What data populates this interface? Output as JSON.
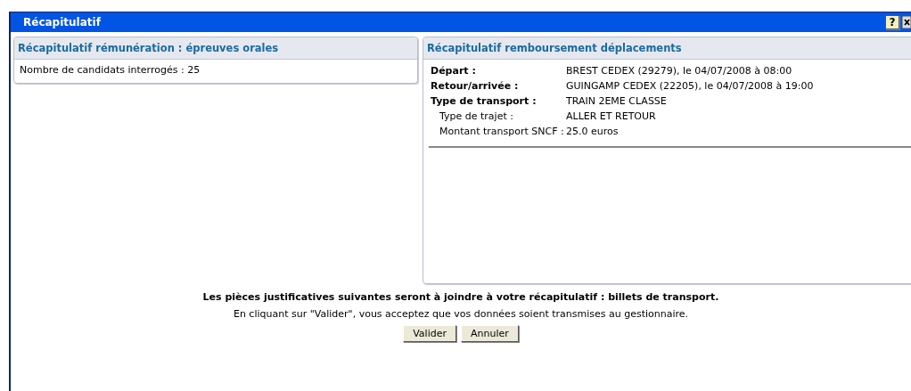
{
  "window": {
    "title": "Récapitulatif",
    "help_button": "?"
  },
  "remuneration": {
    "title": "Récapitulatif rémunération : épreuves orales",
    "line": "Nombre de candidats interrogés : 25"
  },
  "deplacements": {
    "title": "Récapitulatif remboursement déplacements",
    "rows": [
      {
        "kind": "main",
        "label": "Départ :",
        "value": "BREST CEDEX (29279), le 04/07/2008 à 08:00"
      },
      {
        "kind": "main",
        "label": "Retour/arrivée :",
        "value": "GUINGAMP CEDEX (22205), le 04/07/2008 à 19:00"
      },
      {
        "kind": "main",
        "label": "Type de transport :",
        "value": "TRAIN 2EME CLASSE"
      },
      {
        "kind": "sub",
        "label": "Type de trajet :",
        "value": "ALLER ET RETOUR"
      },
      {
        "kind": "sub",
        "label": "Montant transport SNCF :",
        "value": "25.0 euros"
      }
    ]
  },
  "notice": "Les pièces justificatives suivantes seront à joindre à votre récapitulatif : billets de transport.",
  "consent": "En cliquant sur \"Valider\", vous acceptez que vos données soient transmises au gestionnaire.",
  "buttons": [
    "Valider",
    "Annuler"
  ]
}
